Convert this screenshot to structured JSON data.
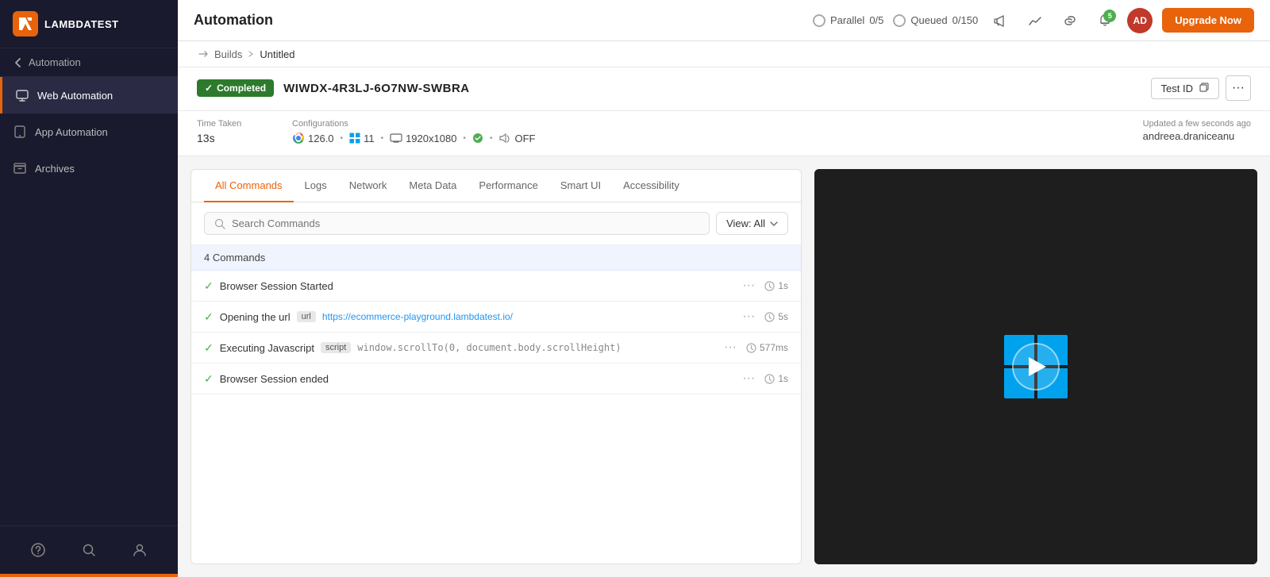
{
  "sidebar": {
    "logo_text": "LAMBDATEST",
    "back_label": "Automation",
    "nav_items": [
      {
        "id": "web-automation",
        "label": "Web Automation",
        "active": true
      },
      {
        "id": "app-automation",
        "label": "App Automation",
        "active": false
      },
      {
        "id": "archives",
        "label": "Archives",
        "active": false
      }
    ]
  },
  "header": {
    "title": "Automation",
    "parallel_label": "Parallel",
    "parallel_value": "0/5",
    "queued_label": "Queued",
    "queued_value": "0/150",
    "notification_count": "5",
    "upgrade_label": "Upgrade Now"
  },
  "breadcrumb": {
    "builds_label": "Builds",
    "current_label": "Untitled"
  },
  "test": {
    "status_badge": "Completed",
    "test_code": "WIWDX-4R3LJ-6O7NW-SWBRA",
    "test_id_label": "Test ID",
    "more_label": "···",
    "time_taken_label": "Time Taken",
    "time_taken_value": "13s",
    "configurations_label": "Configurations",
    "browser_version": "126.0",
    "os_version": "11",
    "resolution": "1920x1080",
    "feature_off": "OFF",
    "updated_label": "Updated a few seconds ago",
    "user": "andreea.draniceanu"
  },
  "tabs": [
    {
      "id": "all-commands",
      "label": "All Commands",
      "active": true
    },
    {
      "id": "logs",
      "label": "Logs",
      "active": false
    },
    {
      "id": "network",
      "label": "Network",
      "active": false
    },
    {
      "id": "meta-data",
      "label": "Meta Data",
      "active": false
    },
    {
      "id": "performance",
      "label": "Performance",
      "active": false
    },
    {
      "id": "smart-ui",
      "label": "Smart UI",
      "active": false
    },
    {
      "id": "accessibility",
      "label": "Accessibility",
      "active": false
    }
  ],
  "search": {
    "placeholder": "Search Commands",
    "view_label": "View: All"
  },
  "commands": {
    "count_label": "4 Commands",
    "items": [
      {
        "id": 1,
        "name": "Browser Session Started",
        "tag": null,
        "value": null,
        "time": "1s"
      },
      {
        "id": 2,
        "name": "Opening the url",
        "tag": "url",
        "value": "https://ecommerce-playground.lambdatest.io/",
        "time": "5s"
      },
      {
        "id": 3,
        "name": "Executing Javascript",
        "tag": "script",
        "value": "window.scrollTo(0, document.body.scrollHeight)",
        "time": "577ms"
      },
      {
        "id": 4,
        "name": "Browser Session ended",
        "tag": null,
        "value": null,
        "time": "1s"
      }
    ]
  },
  "colors": {
    "accent": "#e8630a",
    "success": "#2d7a2d",
    "sidebar_bg": "#1a1a2e",
    "active_tab": "#e8630a"
  }
}
